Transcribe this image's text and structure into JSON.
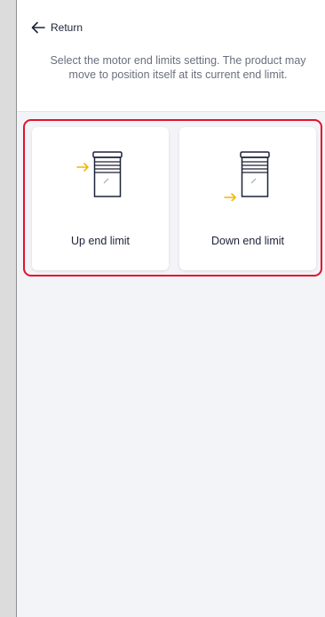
{
  "header": {
    "return_label": "Return",
    "instruction": "Select the motor end limits setting. The product may move to position itself at its current end limit."
  },
  "options": [
    {
      "label": "Up end limit",
      "icon": "shutter-up-limit-icon"
    },
    {
      "label": "Down end limit",
      "icon": "shutter-down-limit-icon"
    }
  ],
  "colors": {
    "accent_arrow": "#f2b705",
    "highlight": "#e2122b",
    "icon_stroke": "#1d2238",
    "background": "#f3f4f8"
  }
}
